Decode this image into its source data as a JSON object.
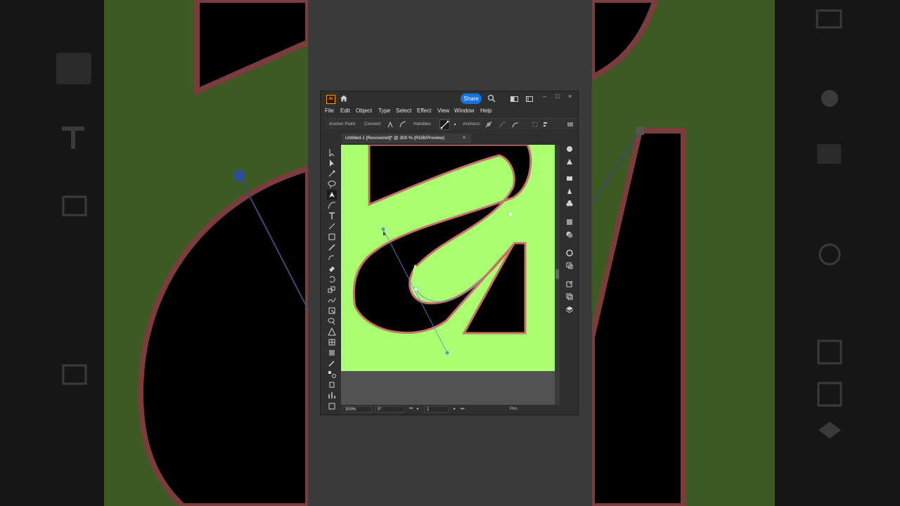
{
  "app": {
    "logo_text": "Ai",
    "share_label": "Share",
    "window_controls": [
      "–",
      "□",
      "×"
    ]
  },
  "menu": [
    "File",
    "Edit",
    "Object",
    "Type",
    "Select",
    "Effect",
    "View",
    "Window",
    "Help"
  ],
  "control_bar": {
    "mode_label": "Anchor Point",
    "convert_label": "Convert:",
    "handles_label": "Handles:",
    "anchors_label": "Anchors:"
  },
  "document": {
    "tab_title": "Untitled-1 [Recovered]* @ 300 % (RGB/Preview)",
    "close_glyph": "×"
  },
  "status": {
    "zoom": "300%",
    "rotation": "0°",
    "artboard": "1",
    "tool": "Pen"
  },
  "tools": [
    "selection",
    "direct-selection",
    "magic-wand",
    "lasso",
    "pen",
    "curvature",
    "type",
    "line-segment",
    "rectangle",
    "paintbrush",
    "shaper",
    "eraser",
    "rotate",
    "scale",
    "warp",
    "free-transform",
    "shape-builder",
    "perspective-grid",
    "mesh",
    "gradient",
    "eyedropper",
    "blend",
    "symbol-sprayer",
    "column-graph",
    "artboard"
  ],
  "right_panel_icons": [
    "properties",
    "appearance",
    "libraries",
    "brushes",
    "symbols",
    "gradient",
    "transparency",
    "stroke",
    "align",
    "export",
    "pathfinder",
    "layers"
  ],
  "colors": {
    "artboard_green": "#aaff70",
    "shape_fill": "#000000",
    "outline": "#c8706e",
    "path_blue": "#5b8fe0",
    "accent": "#1473e6",
    "app_bg": "#2f2f2f"
  }
}
